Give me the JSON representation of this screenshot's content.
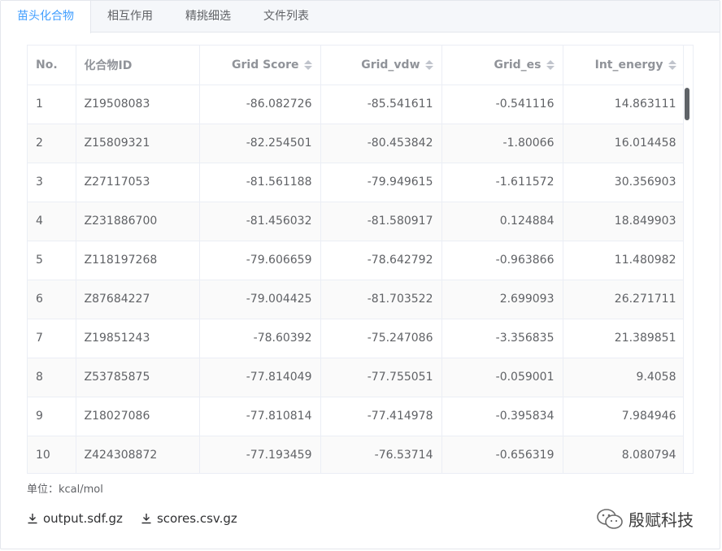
{
  "tabs": [
    {
      "label": "苗头化合物",
      "active": true
    },
    {
      "label": "相互作用",
      "active": false
    },
    {
      "label": "精挑细选",
      "active": false
    },
    {
      "label": "文件列表",
      "active": false
    }
  ],
  "table": {
    "columns": [
      "No.",
      "化合物ID",
      "Grid Score",
      "Grid_vdw",
      "Grid_es",
      "Int_energy"
    ],
    "rows": [
      [
        "1",
        "Z19508083",
        "-86.082726",
        "-85.541611",
        "-0.541116",
        "14.863111"
      ],
      [
        "2",
        "Z15809321",
        "-82.254501",
        "-80.453842",
        "-1.80066",
        "16.014458"
      ],
      [
        "3",
        "Z27117053",
        "-81.561188",
        "-79.949615",
        "-1.611572",
        "30.356903"
      ],
      [
        "4",
        "Z231886700",
        "-81.456032",
        "-81.580917",
        "0.124884",
        "18.849903"
      ],
      [
        "5",
        "Z118197268",
        "-79.606659",
        "-78.642792",
        "-0.963866",
        "11.480982"
      ],
      [
        "6",
        "Z87684227",
        "-79.004425",
        "-81.703522",
        "2.699093",
        "26.271711"
      ],
      [
        "7",
        "Z19851243",
        "-78.60392",
        "-75.247086",
        "-3.356835",
        "21.389851"
      ],
      [
        "8",
        "Z53785875",
        "-77.814049",
        "-77.755051",
        "-0.059001",
        "9.4058"
      ],
      [
        "9",
        "Z18027086",
        "-77.810814",
        "-77.414978",
        "-0.395834",
        "7.984946"
      ],
      [
        "10",
        "Z424308872",
        "-77.193459",
        "-76.53714",
        "-0.656319",
        "8.080794"
      ]
    ]
  },
  "unit_label": "单位：kcal/mol",
  "downloads": [
    {
      "label": "output.sdf.gz",
      "icon": "download-icon"
    },
    {
      "label": "scores.csv.gz",
      "icon": "download-icon"
    }
  ],
  "watermark": {
    "text": "殷赋科技",
    "icon": "wechat-icon"
  },
  "colors": {
    "accent": "#409eff",
    "border": "#ebeef5",
    "header_text": "#909399"
  }
}
